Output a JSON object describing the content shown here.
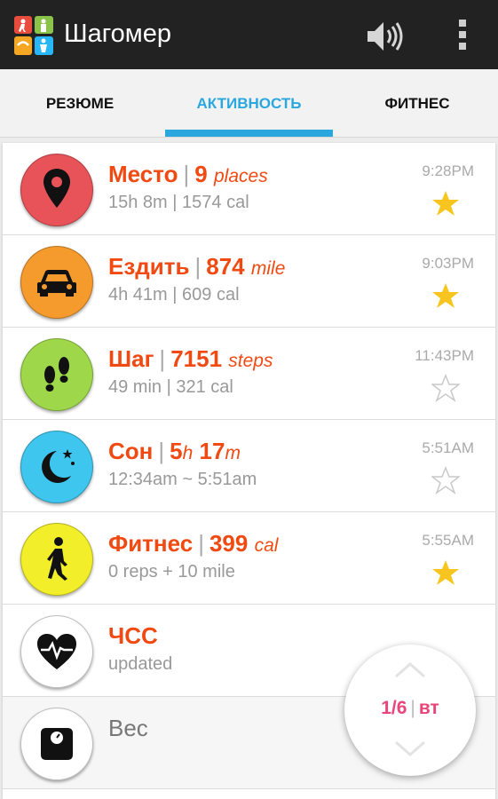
{
  "app": {
    "title": "Шагомер"
  },
  "tabs": [
    {
      "label": "РЕЗЮМЕ",
      "active": false
    },
    {
      "label": "АКТИВНОСТЬ",
      "active": true
    },
    {
      "label": "ФИТНЕС",
      "active": false
    }
  ],
  "activities": [
    {
      "name": "Место",
      "value": "9",
      "unit": "places",
      "sub": "15h 8m  |  1574 cal",
      "time": "9:28PM",
      "starred": true,
      "icon": "location-pin-icon",
      "color": "#e8535a"
    },
    {
      "name": "Ездить",
      "value": "874",
      "unit": "mile",
      "sub": "4h 41m  |  609 cal",
      "time": "9:03PM",
      "starred": true,
      "icon": "car-icon",
      "color": "#f59a2c"
    },
    {
      "name": "Шаг",
      "value": "7151",
      "unit": "steps",
      "sub": "49 min  |  321 cal",
      "time": "11:43PM",
      "starred": false,
      "icon": "footprints-icon",
      "color": "#9ed84a"
    },
    {
      "name": "Сон",
      "value_h": "5",
      "unit_h": "h",
      "value_m": "17",
      "unit_m": "m",
      "sub": "12:34am ~ 5:51am",
      "time": "5:51AM",
      "starred": false,
      "icon": "moon-stars-icon",
      "color": "#3ec6ee"
    },
    {
      "name": "Фитнес",
      "value": "399",
      "unit": "cal",
      "sub": "0 reps + 10 mile",
      "time": "5:55AM",
      "starred": true,
      "icon": "walking-person-icon",
      "color": "#f2ee2a"
    },
    {
      "name": "ЧСС",
      "sub": "updated",
      "icon": "heart-pulse-icon",
      "color": "#ffffff"
    },
    {
      "name": "Вес",
      "icon": "scale-icon",
      "color": "#ffffff"
    }
  ],
  "pager": {
    "position": "1/6",
    "day": "вт"
  },
  "colors": {
    "accent": "#2aa7de",
    "title": "#f04a12",
    "star": "#f7c51e",
    "pager": "#e8457a"
  }
}
